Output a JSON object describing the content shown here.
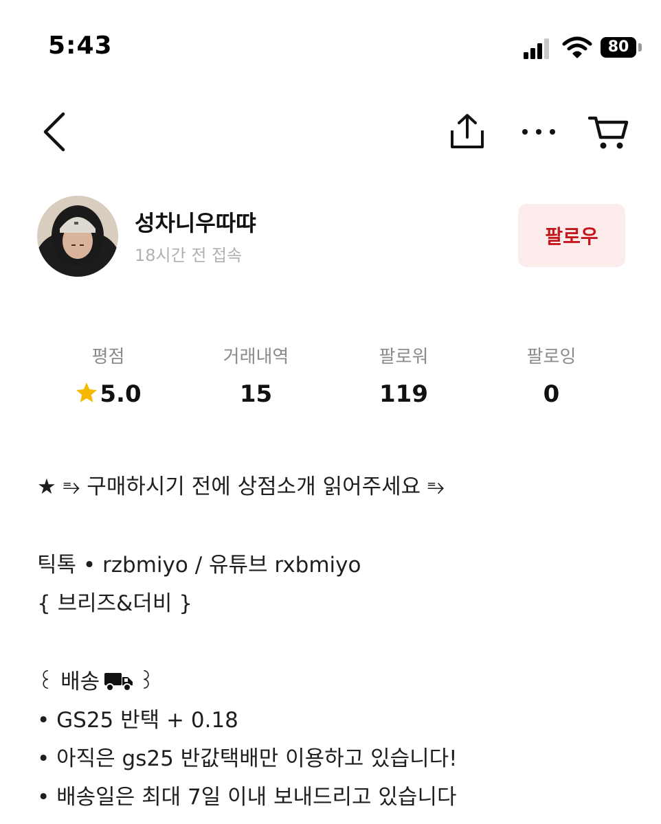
{
  "status_bar": {
    "time": "5:43",
    "battery": "80"
  },
  "nav": {
    "icons": [
      "back-icon",
      "share-icon",
      "more-icon",
      "cart-icon"
    ]
  },
  "profile": {
    "username": "성차니우따땨",
    "last_seen": "18시간 전 접속",
    "follow_label": "팔로우"
  },
  "stats": [
    {
      "label": "평점",
      "value": "5.0"
    },
    {
      "label": "거래내역",
      "value": "15"
    },
    {
      "label": "팔로워",
      "value": "119"
    },
    {
      "label": "팔로잉",
      "value": "0"
    }
  ],
  "description": {
    "line1": "★ ⥱  구매하시기 전에 상점소개 읽어주세요 ⥱",
    "line2": "틱톡 • rzbmiyo / 유튜브 rxbmiyo",
    "line3": "{ 브리즈&더비 }",
    "line4_pre": "꒰ 배송",
    "line4_post": "꒱",
    "line5": "• GS25 반택 + 0.18",
    "line6": "• 아직은 gs25 반값택배만 이용하고 있습니다!",
    "line7": "• 배송일은 최대 7일 이내 보내드리고 있습니다"
  },
  "colors": {
    "accent": "#c4161c",
    "follow_bg": "#fdecec",
    "muted": "#8a8a8a",
    "star": "#f5b800"
  }
}
